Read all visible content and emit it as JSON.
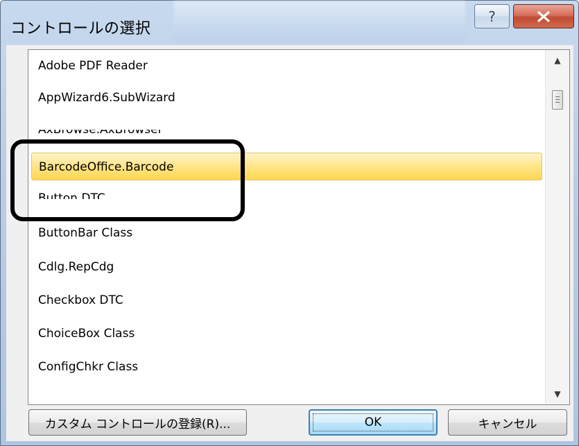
{
  "dialog": {
    "title": "コントロールの選択",
    "help_label": "?",
    "close_label": "x"
  },
  "list": {
    "items": [
      "Adobe PDF Reader",
      "AppWizard6.SubWizard",
      "AxBrowse.AxBrowser",
      "BarcodeOffice.Barcode",
      "Button DTC",
      "ButtonBar Class",
      "Cdlg.RepCdg",
      "Checkbox DTC",
      "ChoiceBox Class",
      "ConfigChkr Class"
    ],
    "selected_item": "BarcodeOffice.Barcode"
  },
  "buttons": {
    "register_label": "カスタム コントロールの登録(R)...",
    "ok_label": "OK",
    "cancel_label": "キャンセル"
  },
  "colors": {
    "selection": "#ffe58a",
    "close_button": "#c24a33",
    "default_button_border": "#3c7fb1"
  },
  "icons": {
    "scroll_up": "scroll-up-arrow-icon",
    "scroll_down": "scroll-down-arrow-icon",
    "help": "help-icon",
    "close": "close-icon"
  }
}
